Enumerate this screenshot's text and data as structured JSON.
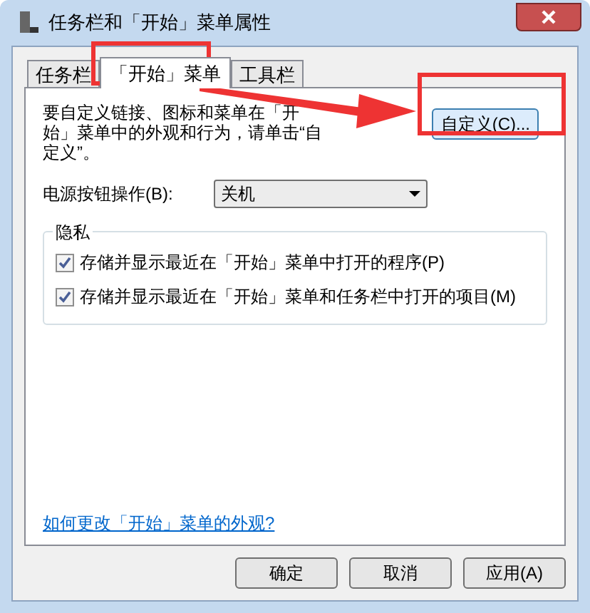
{
  "window": {
    "title": "任务栏和「开始」菜单属性"
  },
  "tabs": [
    {
      "label": "任务栏",
      "selected": false
    },
    {
      "label": "「开始」菜单",
      "selected": true
    },
    {
      "label": "工具栏",
      "selected": false
    }
  ],
  "description": "要自定义链接、图标和菜单在「开始」菜单中的外观和行为，请单击“自定义”。",
  "customize_button": "自定义(C)...",
  "power_button": {
    "label": "电源按钮操作(B):",
    "value": "关机"
  },
  "privacy": {
    "title": "隐私",
    "options": [
      {
        "label": "存储并显示最近在「开始」菜单中打开的程序(P)",
        "checked": true
      },
      {
        "label": "存储并显示最近在「开始」菜单和任务栏中打开的项目(M)",
        "checked": true
      }
    ]
  },
  "help_link": "如何更改「开始」菜单的外观?",
  "buttons": [
    "确定",
    "取消",
    "应用(A)"
  ]
}
